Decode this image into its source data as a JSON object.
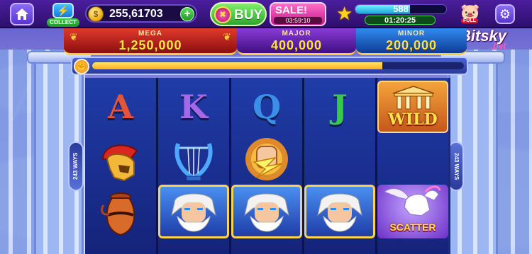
{
  "topbar": {
    "collect_label": "COLLECT",
    "coins": "255,61703",
    "buy_label": "BUY",
    "sale_label": "SALE!",
    "sale_timer": "03:59:10",
    "level_value": "588",
    "level_progress": 0.6,
    "level_timer": "01:20:25",
    "piggy_badge": "FULL"
  },
  "jackpots": {
    "mega": {
      "name": "MEGA",
      "value": "1,250,000"
    },
    "major": {
      "name": "MAJOR",
      "value": "400,000"
    },
    "minor": {
      "name": "MINOR",
      "value": "200,000"
    }
  },
  "progress": {
    "fraction": 0.78
  },
  "brand": {
    "main": "Bitsky",
    "sub": ".bet"
  },
  "ways": {
    "left": "243 WAYS",
    "right": "243 WAYS"
  },
  "reels": {
    "r1": {
      "top": "A"
    },
    "r2": {
      "top": "K"
    },
    "r3": {
      "top": "Q"
    },
    "r4": {
      "top": "J"
    },
    "r5": {
      "wild": "WILD",
      "scatter": "SCATTER"
    }
  },
  "colors": {
    "A": "#e2553a",
    "K": "#a866e8",
    "Q": "#3a8fe8",
    "J": "#3ac84a"
  },
  "icons": [
    "home-icon",
    "collect-icon",
    "coin-icon",
    "plus-icon",
    "buy-icon",
    "star-icon",
    "piggy-bank-icon",
    "gear-icon",
    "jackpot-progress-icon",
    "helmet-symbol",
    "lyre-symbol",
    "fist-lightning-symbol",
    "vase-symbol",
    "zeus-symbol",
    "pegasus-scatter-symbol"
  ]
}
